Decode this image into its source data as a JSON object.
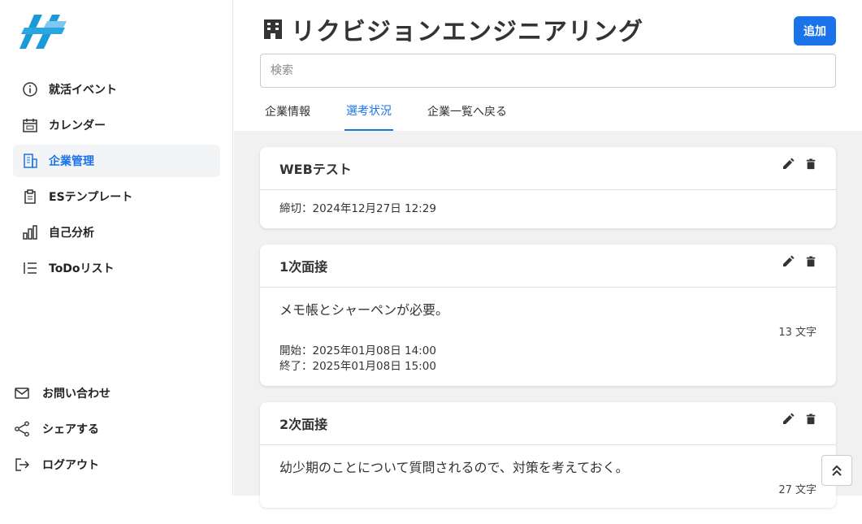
{
  "sidebar": {
    "items": [
      {
        "label": "就活イベント",
        "icon": "info-icon"
      },
      {
        "label": "カレンダー",
        "icon": "calendar-icon"
      },
      {
        "label": "企業管理",
        "icon": "building-icon"
      },
      {
        "label": "ESテンプレート",
        "icon": "clipboard-icon"
      },
      {
        "label": "自己分析",
        "icon": "bar-chart-icon"
      },
      {
        "label": "ToDoリスト",
        "icon": "list-icon"
      }
    ],
    "bottom_items": [
      {
        "label": "お問い合わせ",
        "icon": "mail-icon"
      },
      {
        "label": "シェアする",
        "icon": "share-icon"
      },
      {
        "label": "ログアウト",
        "icon": "logout-icon"
      }
    ]
  },
  "header": {
    "title": "リクビジョンエンジニアリング",
    "add_label": "追加",
    "search_placeholder": "検索"
  },
  "tabs": [
    "企業情報",
    "選考状況",
    "企業一覧へ戻る"
  ],
  "cards": [
    {
      "title": "WEBテスト",
      "deadline": "締切：2024年12月27日 12:29"
    },
    {
      "title": "1次面接",
      "memo": "メモ帳とシャーペンが必要。",
      "count": "13 文字",
      "start": "開始：2025年01月08日 14:00",
      "end": "終了：2025年01月08日 15:00"
    },
    {
      "title": "2次面接",
      "memo": "幼少期のことについて質問されるので、対策を考えておく。",
      "count": "27 文字"
    }
  ],
  "colors": {
    "accent": "#1a73e8",
    "background": "#f1f1f1"
  }
}
